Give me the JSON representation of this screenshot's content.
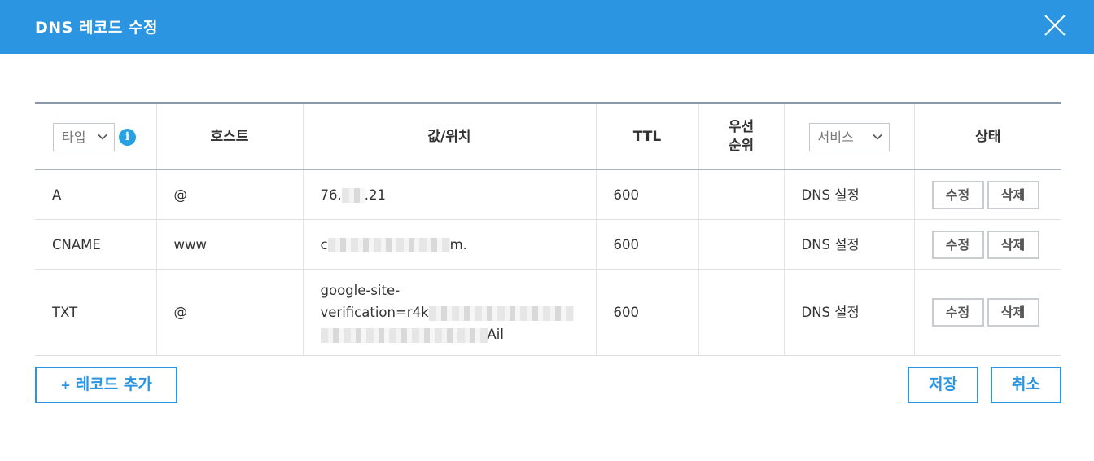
{
  "dialog": {
    "title": "DNS 레코드 수정"
  },
  "table": {
    "columns": {
      "type_select": "타입",
      "host": "호스트",
      "value": "값/위치",
      "ttl": "TTL",
      "priority": "우선\n순위",
      "service_select": "서비스",
      "status": "상태"
    },
    "rows": [
      {
        "type": "A",
        "host": "@",
        "value_prefix": "76.",
        "value_suffix": ".21",
        "ttl": "600",
        "priority": "",
        "service": "DNS 설정",
        "edit": "수정",
        "delete": "삭제"
      },
      {
        "type": "CNAME",
        "host": "www",
        "value_prefix": "c",
        "value_suffix": "m.",
        "ttl": "600",
        "priority": "",
        "service": "DNS 설정",
        "edit": "수정",
        "delete": "삭제"
      },
      {
        "type": "TXT",
        "host": "@",
        "value_line1": "google-site-",
        "value_line2": "verification=r4k",
        "value_line3_suffix": "Ail",
        "ttl": "600",
        "priority": "",
        "service": "DNS 설정",
        "edit": "수정",
        "delete": "삭제"
      }
    ]
  },
  "footer": {
    "add_record": "레코드 추가",
    "add_plus": "+",
    "save": "저장",
    "cancel": "취소"
  },
  "icons": {
    "close": "close-icon",
    "info": "info-icon",
    "chevron": "chevron-down-icon"
  },
  "colors": {
    "header_bg": "#2b95e2",
    "accent": "#2b95e2"
  }
}
